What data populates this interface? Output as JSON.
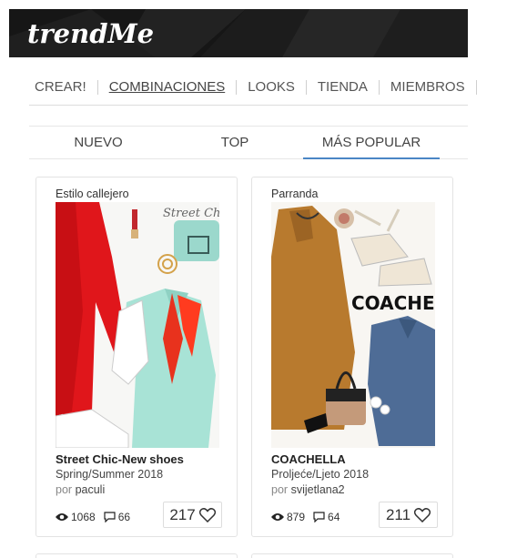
{
  "brand": {
    "logo_text": "trendMe"
  },
  "main_nav": [
    {
      "label": "CREAR!",
      "active": false
    },
    {
      "label": "COMBINACIONES",
      "active": true
    },
    {
      "label": "LOOKS",
      "active": false
    },
    {
      "label": "TIENDA",
      "active": false
    },
    {
      "label": "MIEMBROS",
      "active": false
    }
  ],
  "sub_nav": [
    {
      "label": "NUEVO",
      "active": false
    },
    {
      "label": "TOP",
      "active": false
    },
    {
      "label": "MÁS POPULAR",
      "active": true
    }
  ],
  "cards": [
    {
      "tag": "Estilo callejero",
      "image_text": "Street Chic",
      "title": "Street Chic-New shoes",
      "subtitle": "Spring/Summer 2018",
      "author_prefix": "por",
      "author": "paculi",
      "views": "1068",
      "comments": "66",
      "likes": "217"
    },
    {
      "tag": "Parranda",
      "image_text": "COACHELLA",
      "title": "COACHELLA",
      "subtitle": "Proljeće/Ljeto 2018",
      "author_prefix": "por",
      "author": "svijetlana2",
      "views": "879",
      "comments": "64",
      "likes": "211"
    }
  ],
  "icons": {
    "views": "eye-icon",
    "comments": "comment-icon",
    "likes": "heart-icon"
  }
}
